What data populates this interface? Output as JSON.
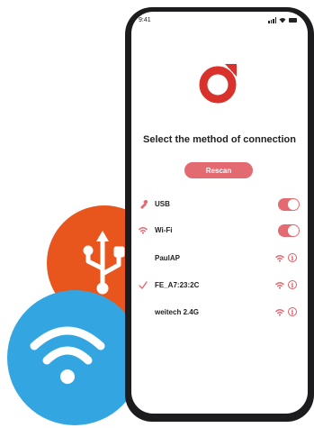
{
  "status_bar": {
    "time": "9:41"
  },
  "title": "Select the method of connection",
  "rescan_label": "Rescan",
  "connections": [
    {
      "label": "USB",
      "icon": "usb-icon",
      "toggle": "on"
    },
    {
      "label": "Wi-Fi",
      "icon": "wifi-icon",
      "toggle": "on"
    }
  ],
  "networks": [
    {
      "name": "PaulAP",
      "selected": false
    },
    {
      "name": "FE_A7:23:2C",
      "selected": true
    },
    {
      "name": "weitech 2.4G",
      "selected": false
    }
  ],
  "colors": {
    "accent": "#e46a71",
    "usb_badge": "#e8561e",
    "wifi_badge": "#33a6e2",
    "logo": "#d9312b"
  }
}
